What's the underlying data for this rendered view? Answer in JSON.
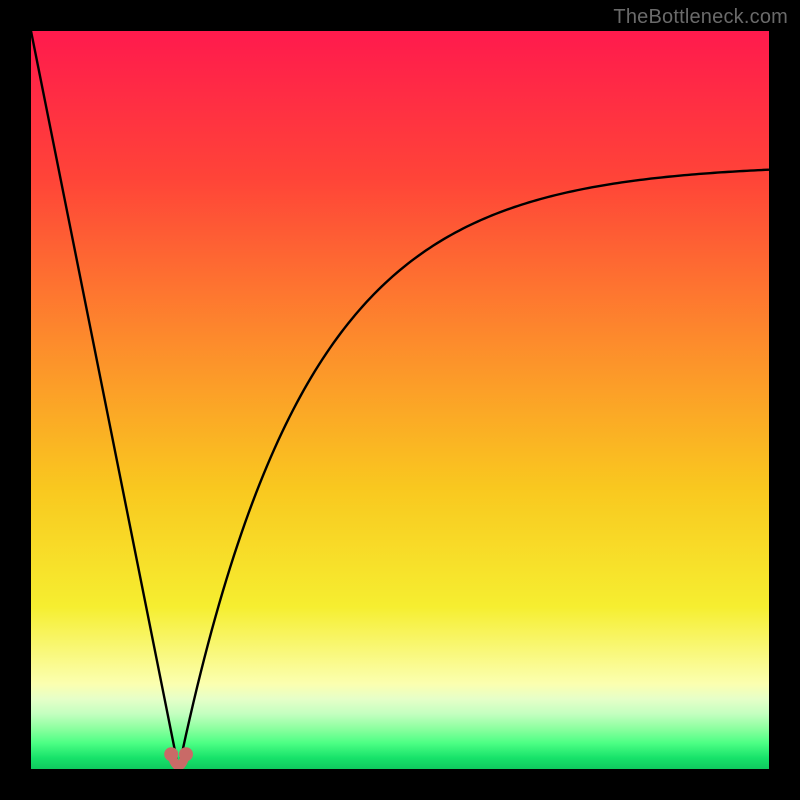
{
  "attribution": "TheBottleneck.com",
  "chart_data": {
    "type": "line",
    "title": "",
    "xlabel": "",
    "ylabel": "",
    "xlim": [
      0,
      100
    ],
    "ylim": [
      0,
      100
    ],
    "grid": false,
    "legend": false,
    "x_min": 20,
    "curve": {
      "note": "V-shaped bottleneck curve. y ≈ 100 at x=0, minimum y≈0 at x≈20, rising toward ~80 at x=100",
      "x": [
        0,
        5,
        10,
        15,
        18,
        19,
        20,
        21,
        22,
        25,
        30,
        40,
        50,
        60,
        70,
        80,
        90,
        100
      ],
      "y": [
        100,
        75,
        50,
        25,
        8,
        2,
        0,
        2,
        6,
        17,
        30,
        47,
        58,
        65,
        71,
        75,
        78,
        80
      ]
    },
    "dip_markers": {
      "x": [
        19,
        21
      ],
      "y": [
        2,
        2
      ],
      "color": "#c96a67"
    },
    "gradient_stops": [
      {
        "offset": 0.0,
        "color": "#ff1a4d"
      },
      {
        "offset": 0.2,
        "color": "#ff4438"
      },
      {
        "offset": 0.42,
        "color": "#fd8b2c"
      },
      {
        "offset": 0.62,
        "color": "#f9c81f"
      },
      {
        "offset": 0.78,
        "color": "#f6ee30"
      },
      {
        "offset": 0.885,
        "color": "#fbffb0"
      },
      {
        "offset": 0.905,
        "color": "#e6ffc8"
      },
      {
        "offset": 0.925,
        "color": "#c4ffc0"
      },
      {
        "offset": 0.945,
        "color": "#8dffa0"
      },
      {
        "offset": 0.965,
        "color": "#4cff84"
      },
      {
        "offset": 0.985,
        "color": "#17e26a"
      },
      {
        "offset": 1.0,
        "color": "#0fc95e"
      }
    ]
  }
}
